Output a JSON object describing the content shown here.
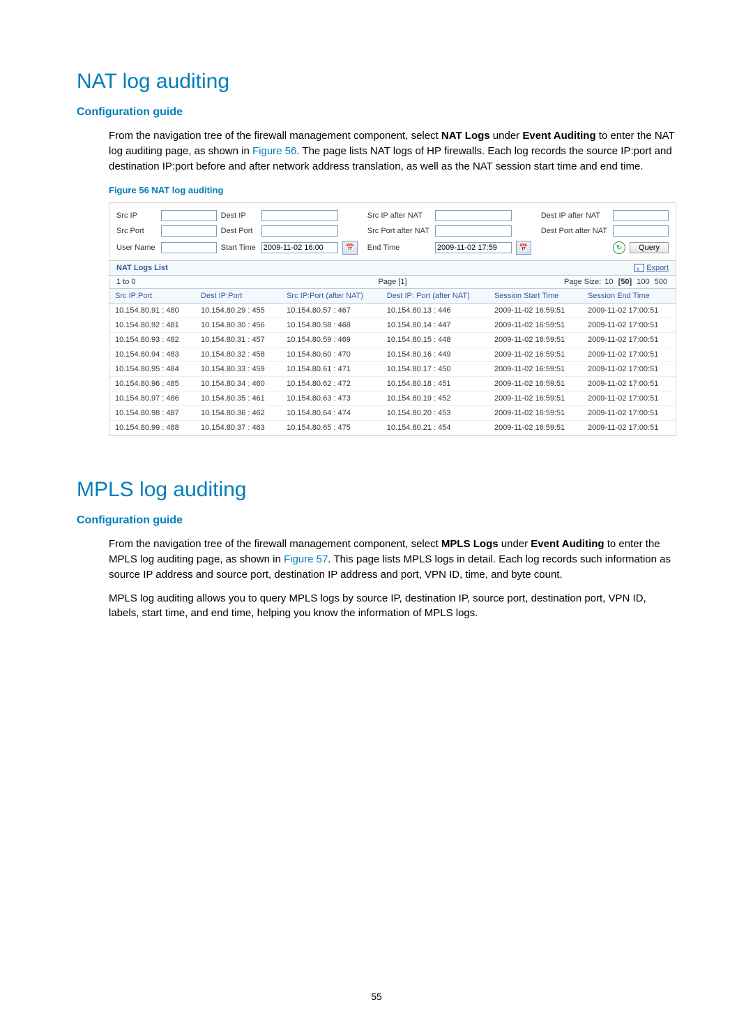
{
  "page_number": "55",
  "nat": {
    "title": "NAT log auditing",
    "guide_heading": "Configuration guide",
    "paragraph_parts": {
      "pre_strong1": "From the navigation tree of the firewall management component, select ",
      "strong1": "NAT Logs",
      "mid1": " under ",
      "strong2": "Event Auditing",
      "mid2": " to enter the NAT log auditing page, as shown in ",
      "figlink": "Figure 56",
      "tail": ". The page lists NAT logs of HP firewalls. Each log records the source IP:port and destination IP:port before and after network address translation, as well as the NAT session start time and end time."
    },
    "figure_caption": "Figure 56 NAT log auditing",
    "filters": {
      "src_ip": "Src IP",
      "dest_ip": "Dest IP",
      "src_ip_after_nat": "Src IP after NAT",
      "dest_ip_after_nat": "Dest IP after NAT",
      "src_port": "Src Port",
      "dest_port": "Dest Port",
      "src_port_after_nat": "Src Port after NAT",
      "dest_port_after_nat": "Dest Port after NAT",
      "user_name": "User Name",
      "start_time": "Start Time",
      "start_time_val": "2009-11-02 16:00",
      "end_time": "End Time",
      "end_time_val": "2009-11-02 17:59",
      "query": "Query"
    },
    "list_header": "NAT Logs List",
    "export": "Export",
    "range": "1 to 0",
    "page_label": "Page",
    "page_current": "[1]",
    "page_size_label": "Page Size:",
    "page_sizes": [
      "10",
      "[50]",
      "100",
      "500"
    ],
    "columns": [
      "Src IP:Port",
      "Dest IP:Port",
      "Src IP:Port (after NAT)",
      "Dest IP: Port (after NAT)",
      "Session Start Time",
      "Session End Time"
    ],
    "rows": [
      [
        "10.154.80.91 : 480",
        "10.154.80.29 : 455",
        "10.154.80.57 : 467",
        "10.154.80.13 : 446",
        "2009-11-02 16:59:51",
        "2009-11-02 17:00:51"
      ],
      [
        "10.154.80.92 : 481",
        "10.154.80.30 : 456",
        "10.154.80.58 : 468",
        "10.154.80.14 : 447",
        "2009-11-02 16:59:51",
        "2009-11-02 17:00:51"
      ],
      [
        "10.154.80.93 : 482",
        "10.154.80.31 : 457",
        "10.154.80.59 : 469",
        "10.154.80.15 : 448",
        "2009-11-02 16:59:51",
        "2009-11-02 17:00:51"
      ],
      [
        "10.154.80.94 : 483",
        "10.154.80.32 : 458",
        "10.154.80.60 : 470",
        "10.154.80.16 : 449",
        "2009-11-02 16:59:51",
        "2009-11-02 17:00:51"
      ],
      [
        "10.154.80.95 : 484",
        "10.154.80.33 : 459",
        "10.154.80.61 : 471",
        "10.154.80.17 : 450",
        "2009-11-02 16:59:51",
        "2009-11-02 17:00:51"
      ],
      [
        "10.154.80.96 : 485",
        "10.154.80.34 : 460",
        "10.154.80.62 : 472",
        "10.154.80.18 : 451",
        "2009-11-02 16:59:51",
        "2009-11-02 17:00:51"
      ],
      [
        "10.154.80.97 : 486",
        "10.154.80.35 : 461",
        "10.154.80.63 : 473",
        "10.154.80.19 : 452",
        "2009-11-02 16:59:51",
        "2009-11-02 17:00:51"
      ],
      [
        "10.154.80.98 : 487",
        "10.154.80.36 : 462",
        "10.154.80.64 : 474",
        "10.154.80.20 : 453",
        "2009-11-02 16:59:51",
        "2009-11-02 17:00:51"
      ],
      [
        "10.154.80.99 : 488",
        "10.154.80.37 : 463",
        "10.154.80.65 : 475",
        "10.154.80.21 : 454",
        "2009-11-02 16:59:51",
        "2009-11-02 17:00:51"
      ]
    ]
  },
  "mpls": {
    "title": "MPLS log auditing",
    "guide_heading": "Configuration guide",
    "p1": {
      "pre_strong1": "From the navigation tree of the firewall management component, select ",
      "strong1": "MPLS Logs",
      "mid1": " under ",
      "strong2": "Event Auditing",
      "mid2": " to enter the MPLS log auditing page, as shown in ",
      "figlink": "Figure 57",
      "tail": ". This page lists MPLS logs in detail. Each log records such information as source IP address and source port, destination IP address and port, VPN ID, time, and byte count."
    },
    "p2": "MPLS log auditing allows you to query MPLS logs by source IP, destination IP, source port, destination port, VPN ID, labels, start time, and end time, helping you know the information of MPLS logs."
  }
}
